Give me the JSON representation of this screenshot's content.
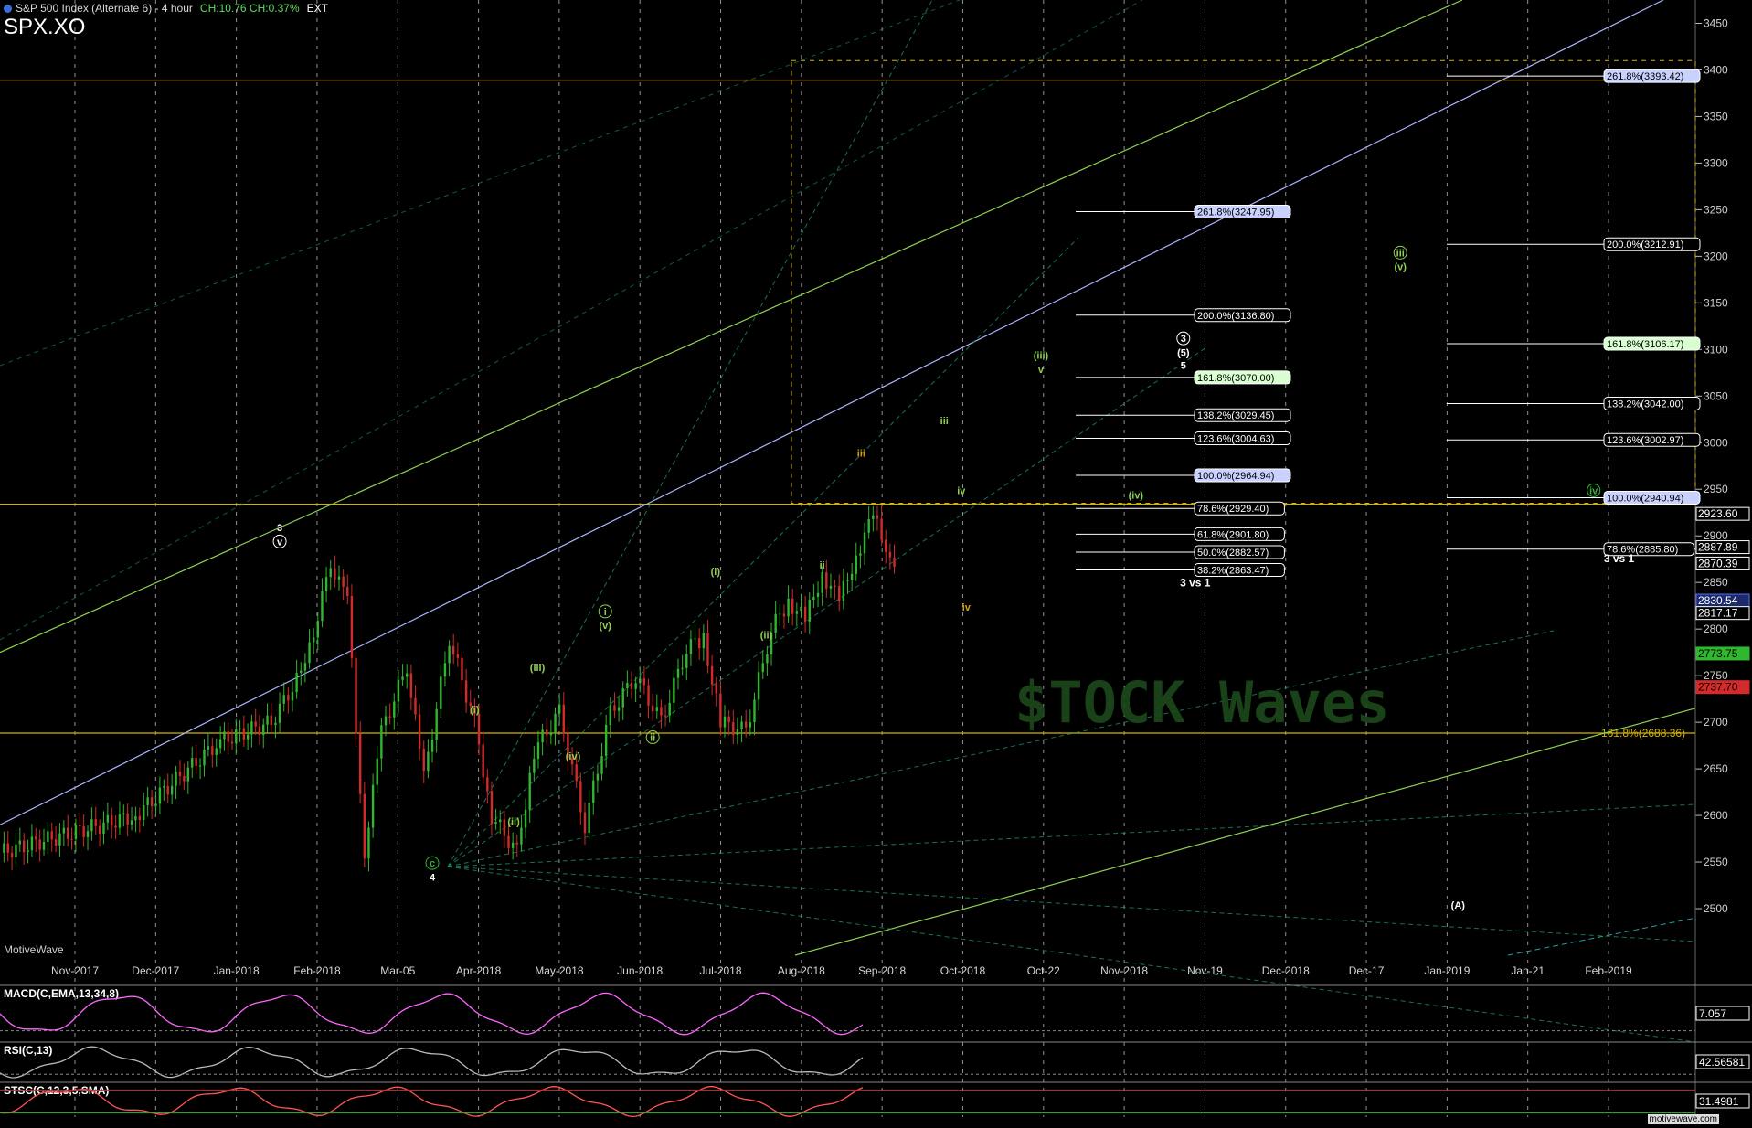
{
  "header": {
    "title": "S&P 500 Index (Alternate 6) - 4 hour",
    "change": "CH:10.76  CH:0.37%",
    "ext": "EXT",
    "symbol": "SPX.XO",
    "brand": "MotiveWave",
    "brand_url": "motivewave.com",
    "watermark": "$TOCK Waves"
  },
  "colors": {
    "bg": "#000000",
    "up": "#2fb82f",
    "down": "#d42a2a",
    "gold": "#d4b200",
    "grid": "#cfcfcf",
    "lightgreen": "#8fd14f",
    "blue": "#aab4ff"
  },
  "chart_data": {
    "type": "line",
    "title": "S&P 500 Index (Alternate 6) - 4 hour",
    "y_axis": {
      "min": 2450,
      "max": 3475,
      "ticks": [
        2500,
        2550,
        2600,
        2650,
        2700,
        2750,
        2800,
        2850,
        2900,
        2950,
        3000,
        3050,
        3100,
        3150,
        3200,
        3250,
        3300,
        3350,
        3400,
        3450
      ],
      "bottom_label": "0"
    },
    "x_ticks": [
      "Nov-2017",
      "Dec-2017",
      "Jan-2018",
      "Feb-2018",
      "Mar-05",
      "Apr-2018",
      "May-2018",
      "Jun-2018",
      "Jul-2018",
      "Aug-2018",
      "Sep-2018",
      "Oct-2018",
      "Oct-22",
      "Nov-2018",
      "Nov-19",
      "Dec-2018",
      "Dec-17",
      "Jan-2019",
      "Jan-21",
      "Feb-2019"
    ],
    "price_waypoints": [
      [
        0.0,
        2560
      ],
      [
        0.08,
        2600
      ],
      [
        0.13,
        2680
      ],
      [
        0.16,
        2700
      ],
      [
        0.18,
        2760
      ],
      [
        0.195,
        2870
      ],
      [
        0.205,
        2830
      ],
      [
        0.215,
        2560
      ],
      [
        0.225,
        2690
      ],
      [
        0.24,
        2760
      ],
      [
        0.25,
        2640
      ],
      [
        0.265,
        2790
      ],
      [
        0.28,
        2700
      ],
      [
        0.29,
        2600
      ],
      [
        0.305,
        2560
      ],
      [
        0.315,
        2670
      ],
      [
        0.33,
        2710
      ],
      [
        0.345,
        2590
      ],
      [
        0.36,
        2710
      ],
      [
        0.375,
        2750
      ],
      [
        0.39,
        2700
      ],
      [
        0.405,
        2780
      ],
      [
        0.415,
        2790
      ],
      [
        0.425,
        2700
      ],
      [
        0.44,
        2690
      ],
      [
        0.455,
        2800
      ],
      [
        0.465,
        2830
      ],
      [
        0.475,
        2810
      ],
      [
        0.485,
        2860
      ],
      [
        0.495,
        2830
      ],
      [
        0.505,
        2880
      ],
      [
        0.515,
        2920
      ],
      [
        0.525,
        2880
      ],
      [
        0.53,
        2870
      ]
    ],
    "price_axis_labels": [
      {
        "value": 2923.6,
        "text": "2923.60",
        "bg": "#000",
        "fg": "#fff",
        "border": "#fff"
      },
      {
        "value": 2887.89,
        "text": "2887.89",
        "bg": "#000",
        "fg": "#fff",
        "border": "#fff"
      },
      {
        "value": 2870.39,
        "text": "2870.39",
        "bg": "#000",
        "fg": "#fff",
        "border": "#fff"
      },
      {
        "value": 2830.54,
        "text": "2830.54",
        "bg": "#1a2a6a",
        "fg": "#fff",
        "border": "#5a6aff"
      },
      {
        "value": 2817.17,
        "text": "2817.17",
        "bg": "#000",
        "fg": "#fff",
        "border": "#fff"
      },
      {
        "value": 2773.75,
        "text": "2773.75",
        "bg": "#2fb82f",
        "fg": "#000",
        "border": "#2fb82f"
      },
      {
        "value": 2737.7,
        "text": "2737.70",
        "bg": "#d42a2a",
        "fg": "#000",
        "border": "#d42a2a"
      }
    ],
    "fib_levels_left": [
      {
        "value": 3247.95,
        "text": "261.8%(3247.95)",
        "style": "blue"
      },
      {
        "value": 3136.8,
        "text": "200.0%(3136.80)",
        "style": "plain"
      },
      {
        "value": 3070.0,
        "text": "161.8%(3070.00)",
        "style": "green"
      },
      {
        "value": 3029.45,
        "text": "138.2%(3029.45)",
        "style": "plain"
      },
      {
        "value": 3004.63,
        "text": "123.6%(3004.63)",
        "style": "plain"
      },
      {
        "value": 2964.94,
        "text": "100.0%(2964.94)",
        "style": "blue"
      },
      {
        "value": 2929.4,
        "text": "78.6%(2929.40)",
        "style": "plain"
      },
      {
        "value": 2901.8,
        "text": "61.8%(2901.80)",
        "style": "plain"
      },
      {
        "value": 2882.57,
        "text": "50.0%(2882.57)",
        "style": "plain"
      },
      {
        "value": 2863.47,
        "text": "38.2%(2863.47)",
        "style": "plain"
      }
    ],
    "fib_levels_right": [
      {
        "value": 3393.42,
        "text": "261.8%(3393.42)",
        "style": "blue"
      },
      {
        "value": 3212.91,
        "text": "200.0%(3212.91)",
        "style": "plain"
      },
      {
        "value": 3106.17,
        "text": "161.8%(3106.17)",
        "style": "green"
      },
      {
        "value": 3042.0,
        "text": "138.2%(3042.00)",
        "style": "plain"
      },
      {
        "value": 3002.97,
        "text": "123.6%(3002.97)",
        "style": "plain"
      },
      {
        "value": 2940.94,
        "text": "100.0%(2940.94)",
        "style": "blue"
      },
      {
        "value": 2885.8,
        "text": "78.6%(2885.80)",
        "style": "plain"
      }
    ],
    "horizontal_lines": [
      {
        "value": 3389,
        "text": ""
      },
      {
        "value": 2934,
        "text": ""
      },
      {
        "value": 2688.36,
        "text": "161.8%(2688.36)"
      }
    ],
    "wave_labels": [
      {
        "x": 0.165,
        "value": 2905,
        "text": "3",
        "color": "#ffffff"
      },
      {
        "x": 0.165,
        "value": 2890,
        "text": "v",
        "color": "#ffffff",
        "circled": true
      },
      {
        "x": 0.255,
        "value": 2545,
        "text": "c",
        "color": "#2fb82f",
        "circled": true
      },
      {
        "x": 0.255,
        "value": 2530,
        "text": "4",
        "color": "#ffffff"
      },
      {
        "x": 0.28,
        "value": 2710,
        "text": "(i)",
        "color": "#8fd14f"
      },
      {
        "x": 0.303,
        "value": 2590,
        "text": "(ii)",
        "color": "#8fd14f"
      },
      {
        "x": 0.317,
        "value": 2755,
        "text": "(iii)",
        "color": "#8fd14f"
      },
      {
        "x": 0.338,
        "value": 2660,
        "text": "(iv)",
        "color": "#8fd14f"
      },
      {
        "x": 0.357,
        "value": 2815,
        "text": "i",
        "color": "#8fd14f",
        "circled": true
      },
      {
        "x": 0.357,
        "value": 2800,
        "text": "(v)",
        "color": "#8fd14f"
      },
      {
        "x": 0.385,
        "value": 2680,
        "text": "ii",
        "color": "#8fd14f",
        "circled": true
      },
      {
        "x": 0.422,
        "value": 2858,
        "text": "(i)",
        "color": "#8fd14f"
      },
      {
        "x": 0.452,
        "value": 2790,
        "text": "(ii)",
        "color": "#8fd14f"
      },
      {
        "x": 0.485,
        "value": 2865,
        "text": "ii",
        "color": "#8fd14f"
      },
      {
        "x": 0.508,
        "value": 2985,
        "text": "iii",
        "color": "#d4a200"
      },
      {
        "x": 0.557,
        "value": 3020,
        "text": "iii",
        "color": "#8fd14f"
      },
      {
        "x": 0.567,
        "value": 2945,
        "text": "iv",
        "color": "#8fd14f"
      },
      {
        "x": 0.57,
        "value": 2820,
        "text": "iv",
        "color": "#d4a200"
      },
      {
        "x": 0.614,
        "value": 3090,
        "text": "(iii)",
        "color": "#8fd14f"
      },
      {
        "x": 0.614,
        "value": 3075,
        "text": "v",
        "color": "#8fd14f"
      },
      {
        "x": 0.67,
        "value": 2940,
        "text": "(iv)",
        "color": "#8fd14f"
      },
      {
        "x": 0.698,
        "value": 3108,
        "text": "3",
        "color": "#ffffff",
        "circled": true
      },
      {
        "x": 0.698,
        "value": 3093,
        "text": "(5)",
        "color": "#ffffff"
      },
      {
        "x": 0.698,
        "value": 3079,
        "text": "5",
        "color": "#ffffff"
      },
      {
        "x": 0.826,
        "value": 3200,
        "text": "iii",
        "color": "#8fd14f",
        "circled": true
      },
      {
        "x": 0.826,
        "value": 3185,
        "text": "(v)",
        "color": "#8fd14f"
      },
      {
        "x": 0.94,
        "value": 2945,
        "text": "iv",
        "color": "#2fb82f",
        "circled": true
      },
      {
        "x": 0.86,
        "value": 2500,
        "text": "(A)",
        "color": "#ffffff"
      }
    ],
    "annotations": [
      {
        "x": 0.705,
        "value": 2846,
        "text": "3 vs 1"
      },
      {
        "x": 0.955,
        "value": 2872,
        "text": "3 vs 1"
      }
    ],
    "indicators": [
      {
        "name": "MACD(C,EMA,13,34,8)",
        "value_label": "7.057"
      },
      {
        "name": "RSI(C,13)",
        "value_label": "42.56581"
      },
      {
        "name": "STSC(C,12,3,5,SMA)",
        "value_label": "31.4981"
      }
    ]
  }
}
